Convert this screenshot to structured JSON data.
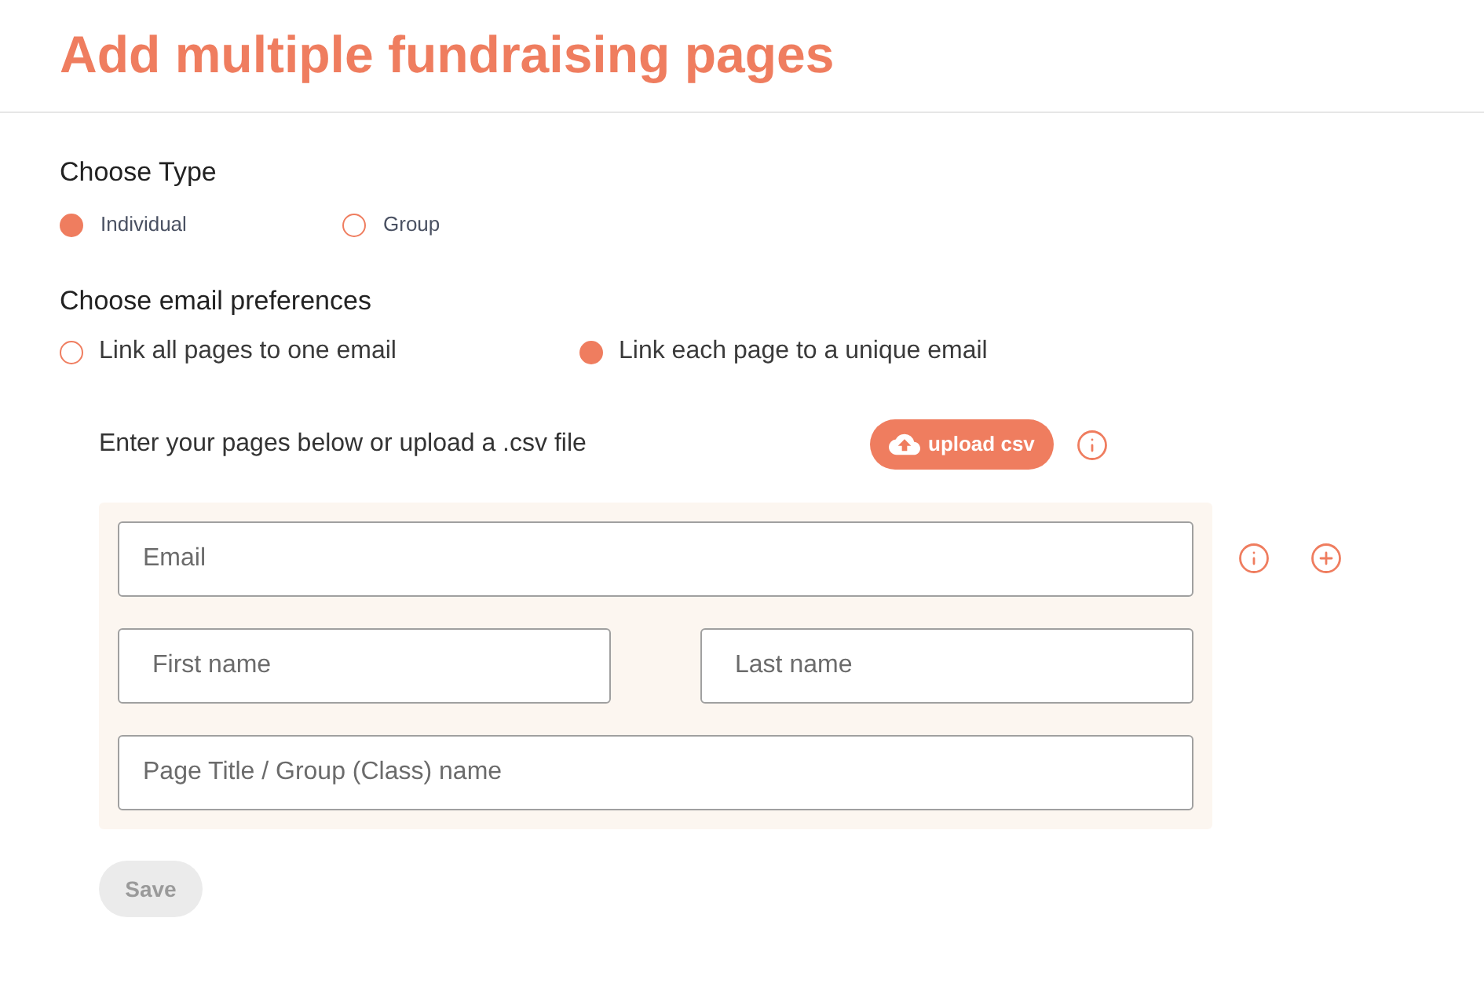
{
  "title": "Add multiple fundraising pages",
  "type_section": {
    "heading": "Choose Type",
    "options": [
      {
        "label": "Individual",
        "selected": true
      },
      {
        "label": "Group",
        "selected": false
      }
    ]
  },
  "email_section": {
    "heading": "Choose email preferences",
    "options": [
      {
        "label": "Link all pages to one email",
        "selected": false
      },
      {
        "label": "Link each page to a unique email",
        "selected": true
      }
    ]
  },
  "pages_section": {
    "instruction": "Enter your pages below or upload a .csv file",
    "upload_button": "upload csv",
    "rows": [
      {
        "fields": [
          {
            "placeholder": "Email"
          }
        ]
      },
      {
        "fields": [
          {
            "placeholder": "First name"
          },
          {
            "placeholder": "Last name"
          }
        ]
      },
      {
        "fields": [
          {
            "placeholder": "Page Title / Group (Class) name"
          }
        ]
      }
    ]
  },
  "save_button": {
    "label": "Save",
    "disabled": true
  }
}
